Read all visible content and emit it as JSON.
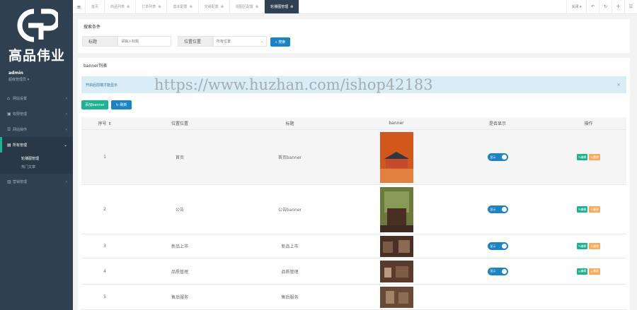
{
  "sidebar": {
    "logo_text": "高品伟业",
    "user_name": "admin",
    "user_role": "超级管理员 ▾",
    "items": [
      {
        "label": "网站设置"
      },
      {
        "label": "权限管理"
      },
      {
        "label": "网站操作"
      },
      {
        "label": "所有管理"
      },
      {
        "label": "营销管理"
      }
    ],
    "sub_items": [
      {
        "label": "轮播图管理"
      },
      {
        "label": "热门文章"
      }
    ]
  },
  "tabs": {
    "items": [
      {
        "label": "首页"
      },
      {
        "label": "商品列表"
      },
      {
        "label": "订单列表"
      },
      {
        "label": "基本配置"
      },
      {
        "label": "交易配置"
      },
      {
        "label": "视图区配置"
      },
      {
        "label": "轮播图管理"
      }
    ],
    "close_label": "关闭 ▾"
  },
  "search": {
    "title": "搜索条件",
    "title_label": "标题",
    "title_placeholder": "请输入标题",
    "position_label": "位置位置",
    "position_value": "所有位置",
    "search_button": "搜索"
  },
  "list": {
    "title": "banner列表",
    "alert": "开启后前端才能显示",
    "add_button": "添加banner",
    "refresh_button": "刷新",
    "columns": [
      "序号 ⇕",
      "位置位置",
      "标题",
      "banner",
      "是否显示",
      "操作"
    ],
    "rows": [
      {
        "id": "1",
        "position": "首页",
        "title": "首页banner",
        "toggle": "显示",
        "edit": "编辑",
        "del": "删除"
      },
      {
        "id": "2",
        "position": "公告",
        "title": "公告banner",
        "toggle": "显示",
        "edit": "编辑",
        "del": "删除"
      },
      {
        "id": "3",
        "position": "新品上市",
        "title": "新品上市",
        "toggle": "显示",
        "edit": "编辑",
        "del": "删除"
      },
      {
        "id": "4",
        "position": "品质管理",
        "title": "品质管理",
        "toggle": "显示",
        "edit": "编辑",
        "del": "删除"
      },
      {
        "id": "5",
        "position": "售后服务",
        "title": "售后服务",
        "toggle": "显示",
        "edit": "编辑",
        "del": "删除"
      }
    ]
  },
  "watermark": "https://www.huzhan.com/ishop42183",
  "colors": {
    "sidebar": "#2f4050",
    "primary": "#1ab394",
    "info": "#1c84c6",
    "warning": "#f8ac59",
    "alert_bg": "#d9edf7"
  }
}
